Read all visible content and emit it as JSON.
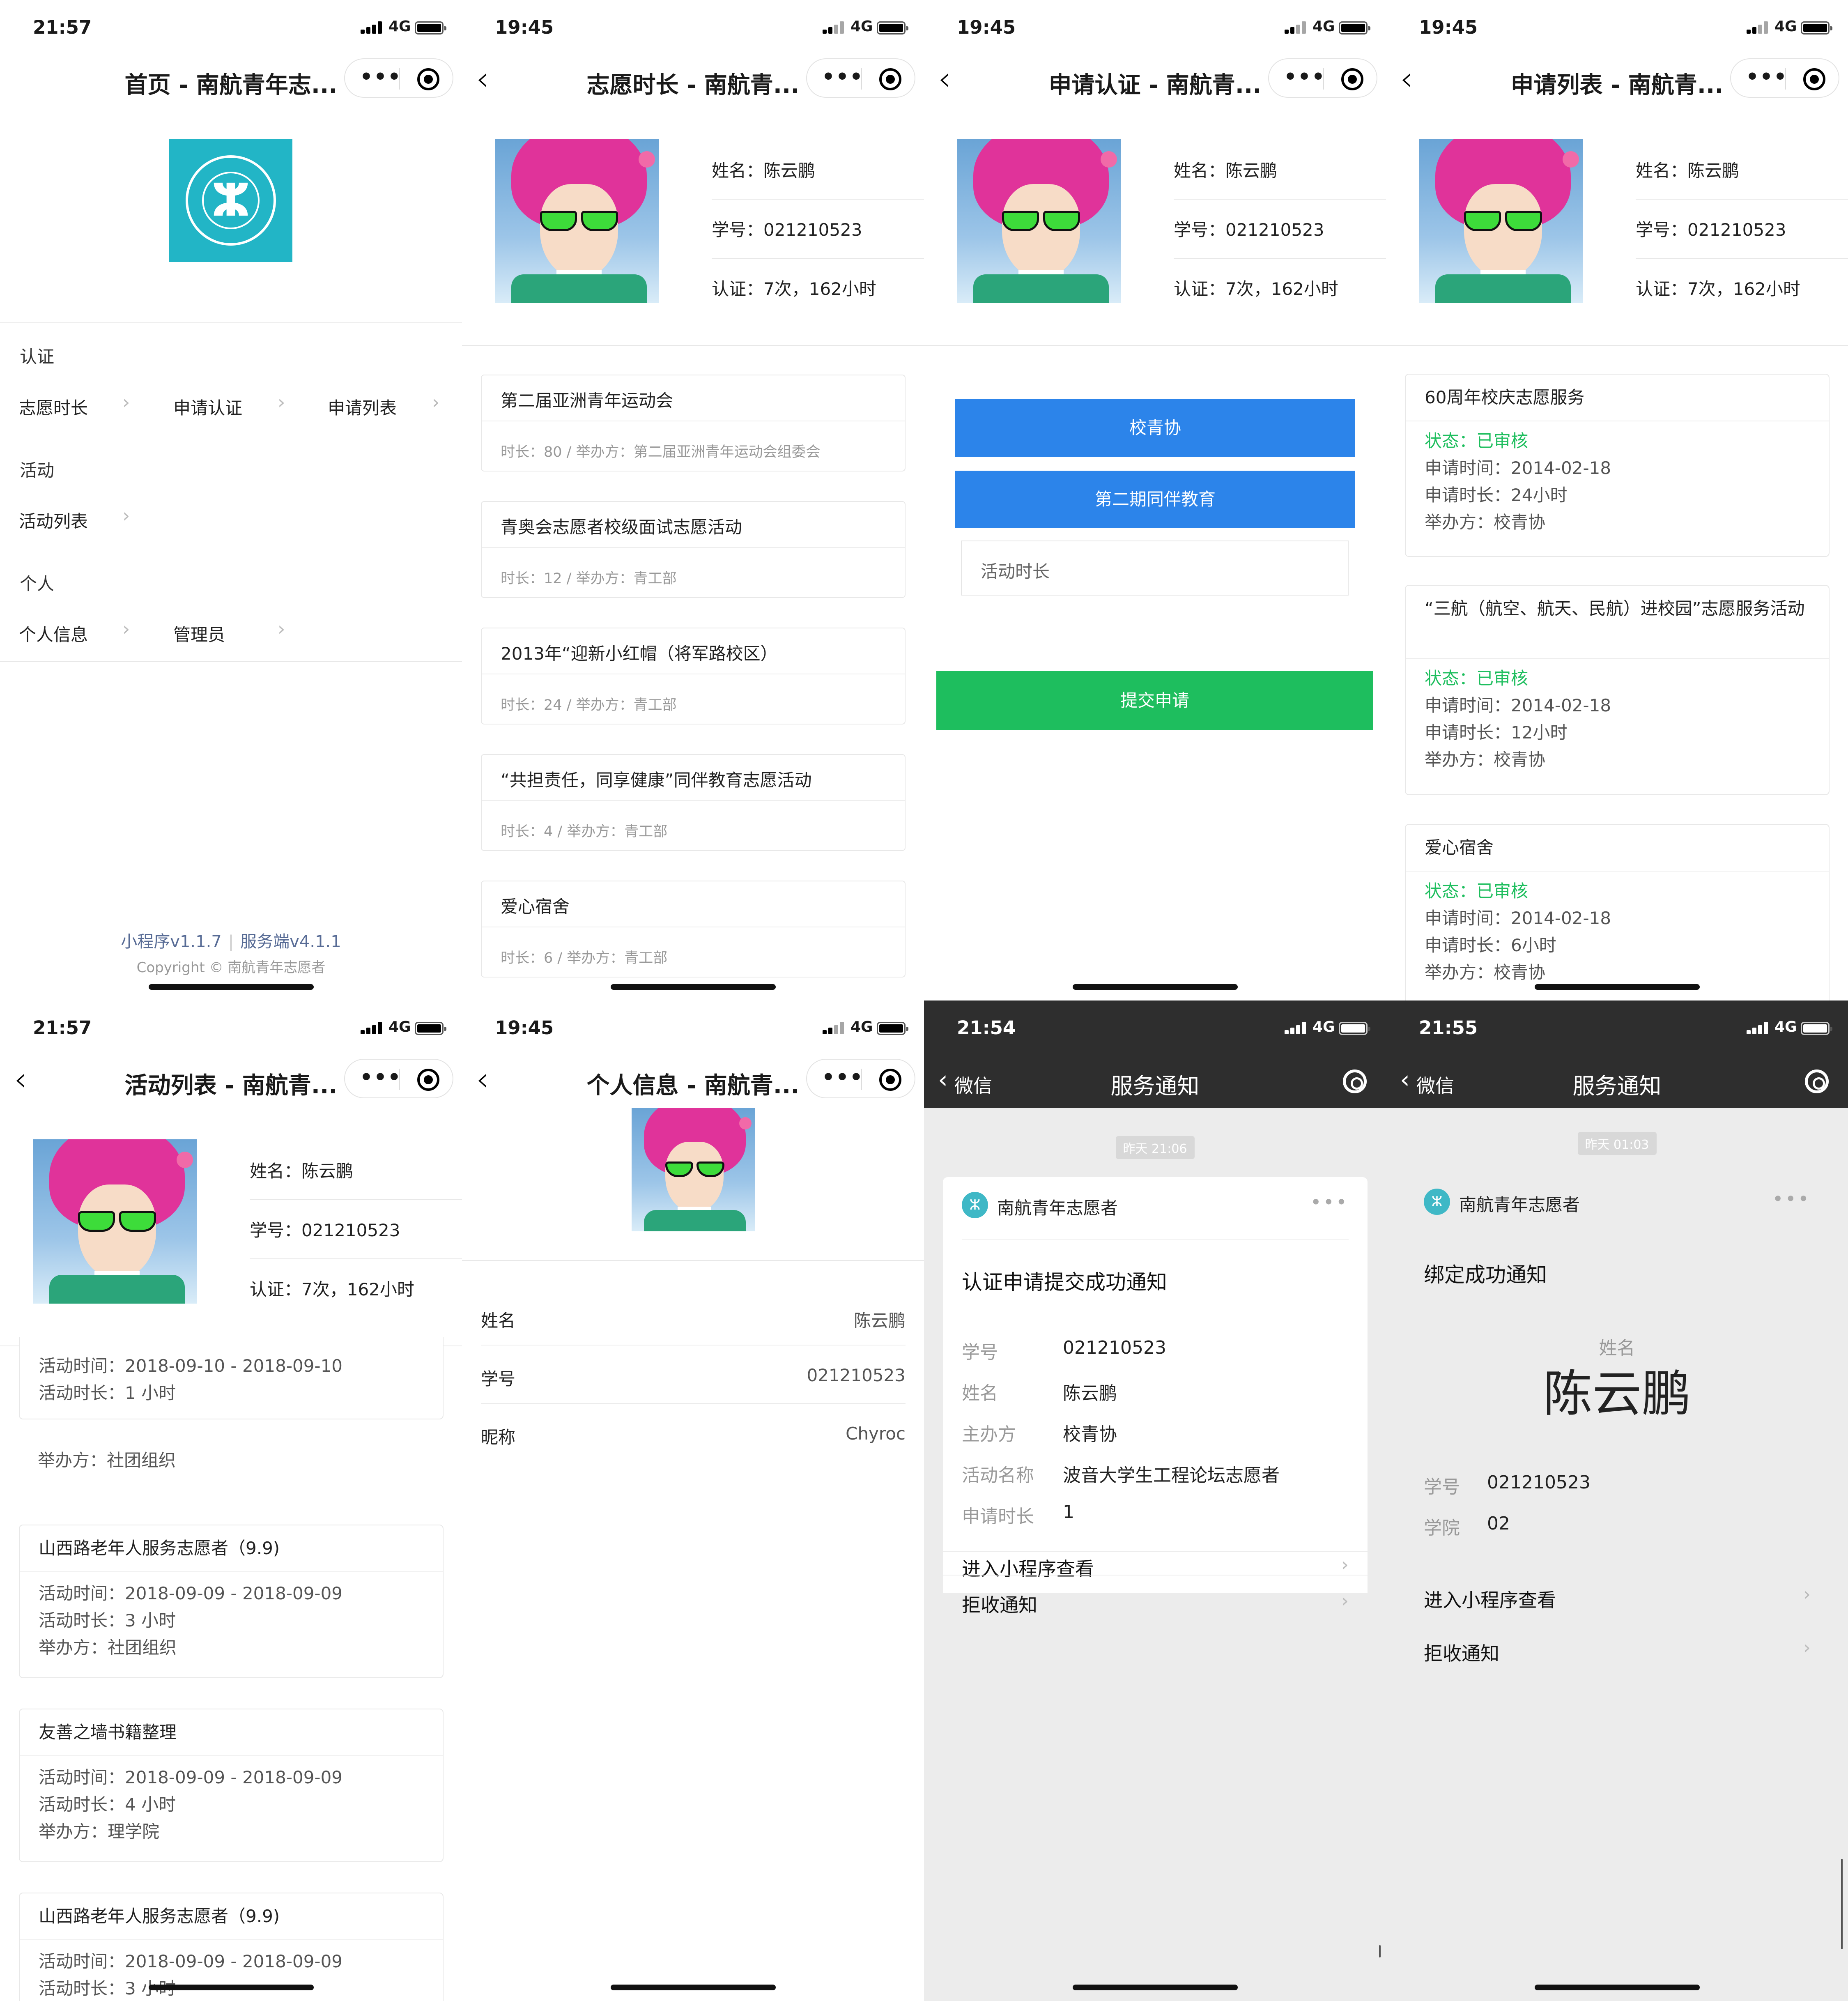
{
  "status_bars": [
    {
      "time": "21:57",
      "net": "4G"
    },
    {
      "time": "19:45",
      "net": "4G"
    },
    {
      "time": "19:45",
      "net": "4G"
    },
    {
      "time": "19:45",
      "net": "4G"
    },
    {
      "time": "21:57",
      "net": "4G"
    },
    {
      "time": "19:45",
      "net": "4G"
    },
    {
      "time": "21:54",
      "net": "4G"
    },
    {
      "time": "21:55",
      "net": "4G"
    }
  ],
  "capsule": {
    "dots": "•••"
  },
  "profile": {
    "name_line": "姓名：陈云鹏",
    "id_line": "学号：021210523",
    "cert_line": "认证：7次，162小时"
  },
  "home": {
    "title": "首页 - 南航青年志...",
    "logo_glyph": "ⵣ",
    "sections": [
      {
        "label": "认证",
        "items": [
          "志愿时长",
          "申请认证",
          "申请列表"
        ]
      },
      {
        "label": "活动",
        "items": [
          "活动列表"
        ]
      },
      {
        "label": "个人",
        "items": [
          "个人信息",
          "管理员"
        ]
      }
    ],
    "chevron": "›",
    "version_client": "小程序v1.1.7",
    "version_sep": "|",
    "version_server": "服务端v4.1.1",
    "copyright": "Copyright © 南航青年志愿者"
  },
  "hours": {
    "title": "志愿时长 - 南航青...",
    "cards": [
      {
        "title": "第二届亚洲青年运动会",
        "sub": "时长：80 / 举办方：第二届亚洲青年运动会组委会"
      },
      {
        "title": "青奥会志愿者校级面试志愿活动",
        "sub": "时长：12 / 举办方：青工部"
      },
      {
        "title": "2013年“迎新小红帽（将军路校区）",
        "sub": "时长：24 / 举办方：青工部"
      },
      {
        "title": "“共担责任，同享健康”同伴教育志愿活动",
        "sub": "时长：4 / 举办方：青工部"
      },
      {
        "title": "爱心宿舍",
        "sub": "时长：6 / 举办方：青工部"
      }
    ]
  },
  "apply": {
    "title": "申请认证 - 南航青...",
    "org_button": "校青协",
    "activity_button": "第二期同伴教育",
    "hours_placeholder": "活动时长",
    "submit": "提交申请"
  },
  "applist": {
    "title": "申请列表 - 南航青...",
    "cards": [
      {
        "title": "60周年校庆志愿服务",
        "status": "状态：已审核",
        "time": "申请时间：2014-02-18",
        "hours": "申请时长：24小时",
        "org": "举办方：校青协"
      },
      {
        "title": "“三航（航空、航天、民航）进校园”志愿服务活动",
        "status": "状态：已审核",
        "time": "申请时间：2014-02-18",
        "hours": "申请时长：12小时",
        "org": "举办方：校青协"
      },
      {
        "title": "爱心宿舍",
        "status": "状态：已审核",
        "time": "申请时间：2014-02-18",
        "hours": "申请时长：6小时",
        "org": "举办方：校青协"
      }
    ]
  },
  "activities": {
    "title": "活动列表 - 南航青...",
    "partial_top": {
      "time": "活动时间：2018-09-10 - 2018-09-10",
      "hours": "活动时长：1 小时",
      "org": "举办方：社团组织"
    },
    "cards": [
      {
        "title": "山西路老年人服务志愿者（9.9)",
        "time": "活动时间：2018-09-09 - 2018-09-09",
        "hours": "活动时长：3 小时",
        "org": "举办方：社团组织"
      },
      {
        "title": "友善之墙书籍整理",
        "time": "活动时间：2018-09-09 - 2018-09-09",
        "hours": "活动时长：4 小时",
        "org": "举办方：理学院"
      },
      {
        "title": "山西路老年人服务志愿者（9.9)",
        "time": "活动时间：2018-09-09 - 2018-09-09",
        "hours": "活动时长：3 小时",
        "org": ""
      }
    ]
  },
  "personal": {
    "title": "个人信息 - 南航青...",
    "rows": [
      {
        "k": "姓名",
        "v": "陈云鹏"
      },
      {
        "k": "学号",
        "v": "021210523"
      },
      {
        "k": "昵称",
        "v": "Chyroc"
      }
    ]
  },
  "notify1": {
    "back": "微信",
    "title": "服务通知",
    "stamp": "昨天 21:06",
    "account": "南航青年志愿者",
    "more": "•••",
    "heading": "认证申请提交成功通知",
    "fields": [
      {
        "k": "学号",
        "v": "021210523"
      },
      {
        "k": "姓名",
        "v": "陈云鹏"
      },
      {
        "k": "主办方",
        "v": "校青协"
      },
      {
        "k": "活动名称",
        "v": "波音大学生工程论坛志愿者"
      },
      {
        "k": "申请时长",
        "v": "1"
      }
    ],
    "open": "进入小程序查看",
    "reject": "拒收通知"
  },
  "notify2": {
    "back": "微信",
    "title": "服务通知",
    "stamp": "昨天 01:03",
    "account": "南航青年志愿者",
    "more": "•••",
    "heading": "绑定成功通知",
    "big_label": "姓名",
    "big_name": "陈云鹏",
    "fields": [
      {
        "k": "学号",
        "v": "021210523"
      },
      {
        "k": "学院",
        "v": "02"
      }
    ],
    "open": "进入小程序查看",
    "reject": "拒收通知"
  },
  "colors": {
    "blue": "#2c84ea",
    "green": "#1ebe5e",
    "link": "#576b95",
    "teal": "#22b5c6"
  }
}
